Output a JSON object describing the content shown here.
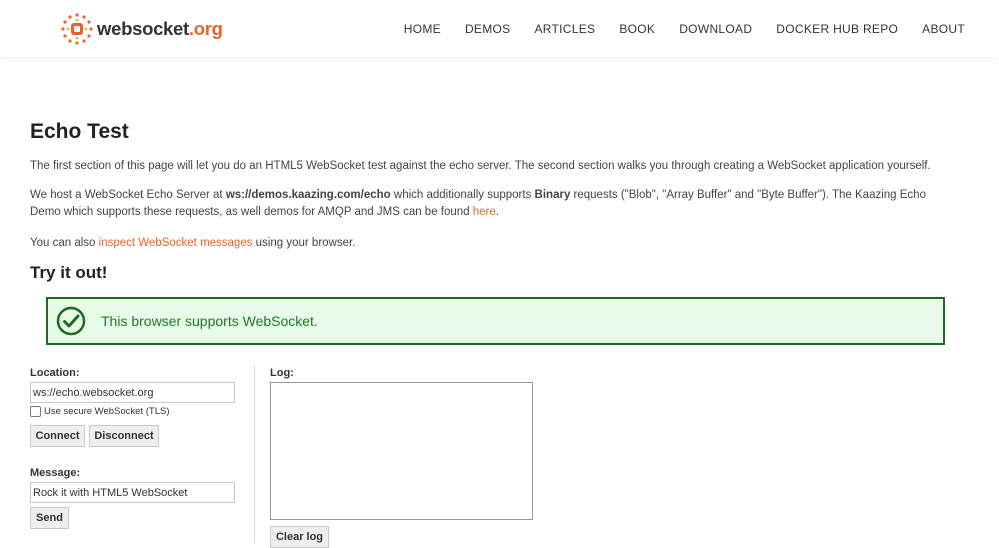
{
  "header": {
    "logo_main": "websocket",
    "logo_tld": ".org",
    "nav": [
      "HOME",
      "DEMOS",
      "ARTICLES",
      "BOOK",
      "DOWNLOAD",
      "DOCKER HUB REPO",
      "ABOUT"
    ]
  },
  "main": {
    "title": "Echo Test",
    "intro": "The first section of this page will let you do an HTML5 WebSocket test against the echo server. The second section walks you through creating a WebSocket application yourself.",
    "host_prefix": "We host a WebSocket Echo Server at ",
    "host_url": "ws://demos.kaazing.com/echo",
    "host_mid": " which additionally supports ",
    "host_binary": "Binary",
    "host_rest": " requests (\"Blob\", \"Array Buffer\" and \"Byte Buffer\"). The Kaazing Echo Demo which supports these requests, as well demos for AMQP and JMS can be found ",
    "host_link": "here",
    "host_end": ".",
    "inspect_prefix": "You can also ",
    "inspect_link": "inspect WebSocket messages",
    "inspect_suffix": " using your browser.",
    "try_title": "Try it out!",
    "support_message": "This browser supports WebSocket."
  },
  "form": {
    "location_label": "Location:",
    "location_value": "ws://echo.websocket.org",
    "tls_label": "Use secure WebSocket (TLS)",
    "connect_label": "Connect",
    "disconnect_label": "Disconnect",
    "message_label": "Message:",
    "message_value": "Rock it with HTML5 WebSocket",
    "send_label": "Send",
    "log_label": "Log:",
    "clear_log_label": "Clear log"
  },
  "colors": {
    "accent": "#e8632c",
    "success_bg": "#e8fbe9",
    "success_border": "#1f6a22",
    "success_text": "#1e7a22"
  },
  "icons": {
    "logo": "websocket-logo-icon",
    "support": "check-circle-icon"
  }
}
